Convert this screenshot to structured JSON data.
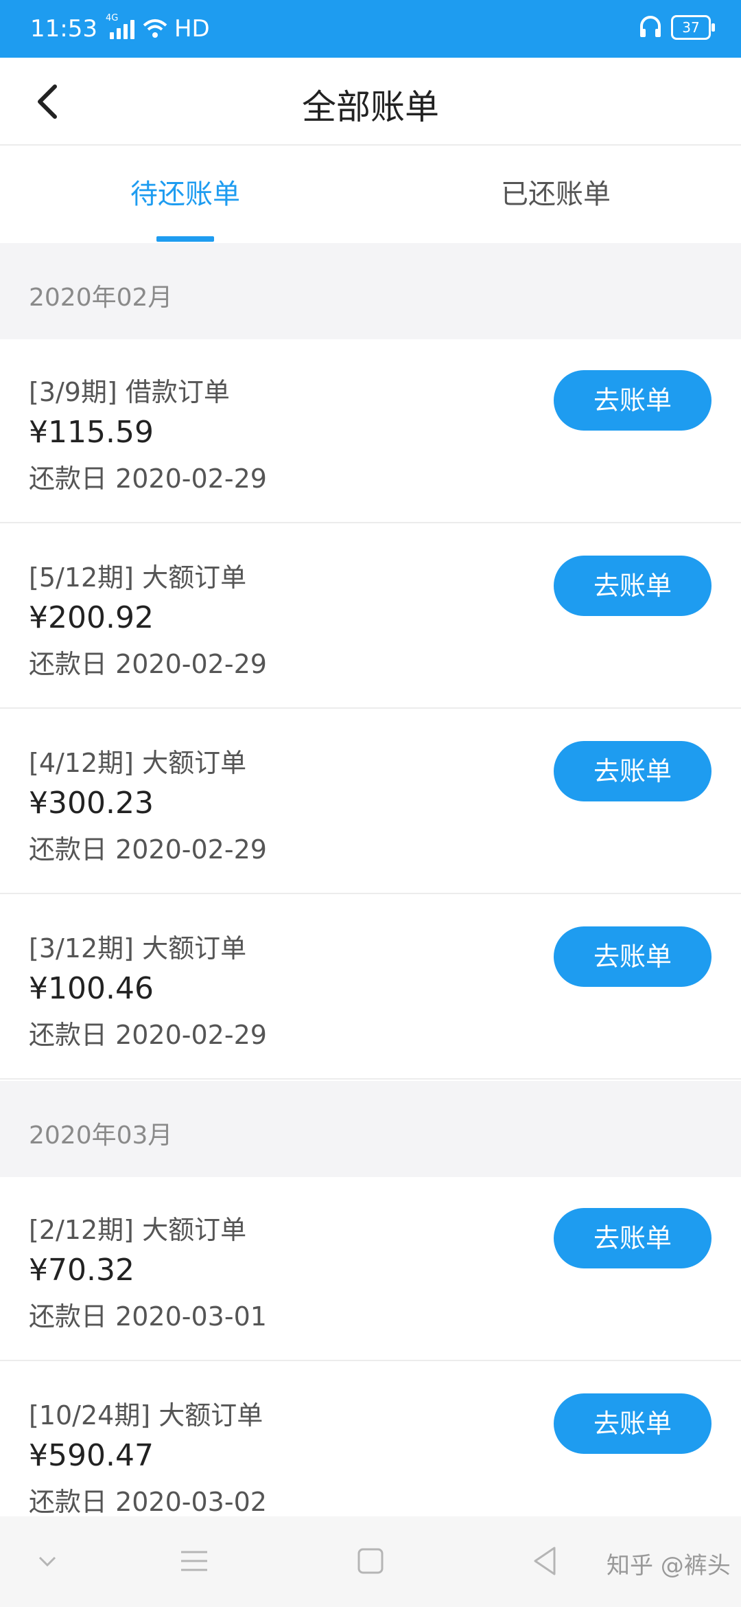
{
  "status_bar": {
    "time": "11:53",
    "network": "4G",
    "hd": "HD",
    "battery": "37",
    "icons": [
      "signal-icon",
      "wifi-icon",
      "headset-icon",
      "battery-icon"
    ]
  },
  "header": {
    "title": "全部账单",
    "back_icon": "chevron-left-icon"
  },
  "tabs": [
    {
      "label": "待还账单",
      "active": true
    },
    {
      "label": "已还账单",
      "active": false
    }
  ],
  "groups": [
    {
      "month": "2020年02月",
      "items": [
        {
          "period": "[3/9期] 借款订单",
          "amount": "¥115.59",
          "due": "还款日 2020-02-29",
          "button": "去账单"
        },
        {
          "period": "[5/12期] 大额订单",
          "amount": "¥200.92",
          "due": "还款日 2020-02-29",
          "button": "去账单"
        },
        {
          "period": "[4/12期] 大额订单",
          "amount": "¥300.23",
          "due": "还款日 2020-02-29",
          "button": "去账单"
        },
        {
          "period": "[3/12期] 大额订单",
          "amount": "¥100.46",
          "due": "还款日 2020-02-29",
          "button": "去账单"
        }
      ]
    },
    {
      "month": "2020年03月",
      "items": [
        {
          "period": "[2/12期] 大额订单",
          "amount": "¥70.32",
          "due": "还款日 2020-03-01",
          "button": "去账单"
        },
        {
          "period": "[10/24期] 大额订单",
          "amount": "¥590.47",
          "due": "还款日 2020-03-02",
          "button": "去账单"
        }
      ]
    }
  ],
  "system_nav": {
    "icons": [
      "chevron-down-icon",
      "menu-icon",
      "home-square-icon",
      "back-triangle-icon"
    ],
    "watermark": "知乎 @裤头"
  },
  "colors": {
    "accent": "#1E9CF0",
    "section_bg": "#f4f4f6"
  }
}
